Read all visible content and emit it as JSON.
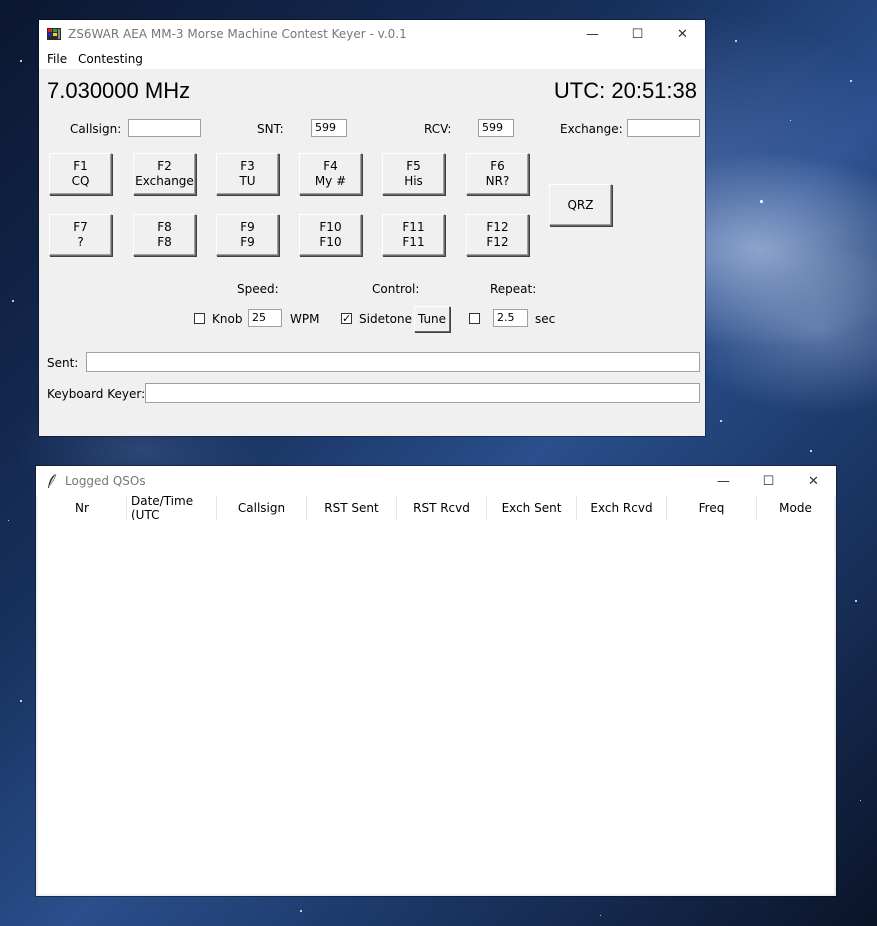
{
  "keyer_window": {
    "title": "ZS6WAR AEA MM-3 Morse Machine Contest Keyer - v.0.1",
    "menu": [
      "File",
      "Contesting"
    ],
    "frequency": "7.030000 MHz",
    "utc_clock": "UTC: 20:51:38",
    "fields": {
      "callsign_label": "Callsign:",
      "callsign_value": "",
      "snt_label": "SNT:",
      "snt_value": "599",
      "rcv_label": "RCV:",
      "rcv_value": "599",
      "exchange_label": "Exchange:",
      "exchange_value": ""
    },
    "fkeys": [
      {
        "key": "F1",
        "text": "CQ"
      },
      {
        "key": "F2",
        "text": "Exchange"
      },
      {
        "key": "F3",
        "text": "TU"
      },
      {
        "key": "F4",
        "text": "My #"
      },
      {
        "key": "F5",
        "text": "His"
      },
      {
        "key": "F6",
        "text": "NR?"
      },
      {
        "key": "F7",
        "text": "?"
      },
      {
        "key": "F8",
        "text": "F8"
      },
      {
        "key": "F9",
        "text": "F9"
      },
      {
        "key": "F10",
        "text": "F10"
      },
      {
        "key": "F11",
        "text": "F11"
      },
      {
        "key": "F12",
        "text": "F12"
      }
    ],
    "qrz_label": "QRZ",
    "speed": {
      "label": "Speed:",
      "knob_label": "Knob",
      "knob_checked": false,
      "wpm_value": "25",
      "wpm_label": "WPM"
    },
    "control": {
      "label": "Control:",
      "sidetone_label": "Sidetone",
      "sidetone_checked": true,
      "tune_label": "Tune"
    },
    "repeat": {
      "label": "Repeat:",
      "checked": false,
      "value": "2.5",
      "unit": "sec"
    },
    "sent_label": "Sent:",
    "sent_value": "",
    "keyboard_keyer_label": "Keyboard Keyer:",
    "keyboard_keyer_value": ""
  },
  "log_window": {
    "title": "Logged QSOs",
    "columns": [
      "Nr",
      "Date/Time (UTC",
      "Callsign",
      "RST Sent",
      "RST Rcvd",
      "Exch Sent",
      "Exch Rcvd",
      "Freq",
      "Mode"
    ],
    "rows": []
  },
  "window_controls": {
    "minimize": "—",
    "maximize": "☐",
    "close": "✕"
  }
}
